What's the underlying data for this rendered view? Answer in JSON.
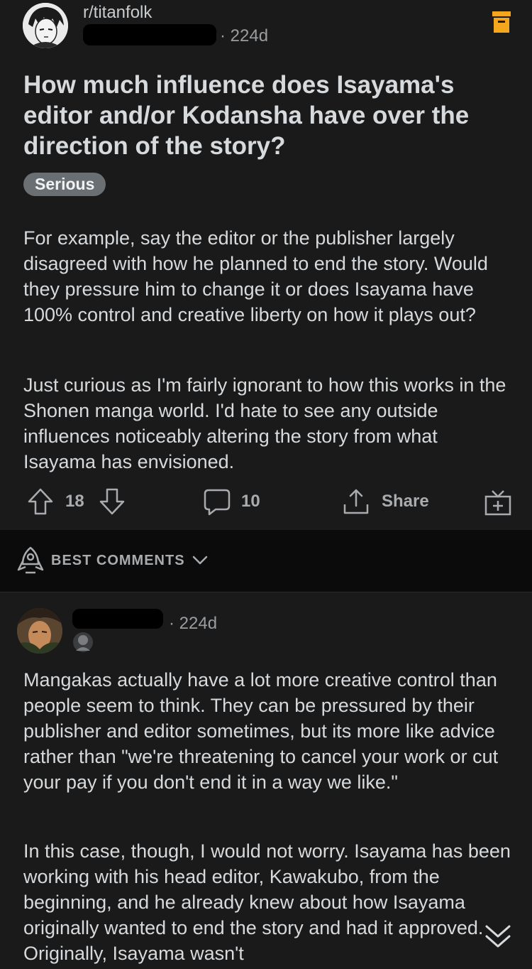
{
  "post": {
    "subreddit": "r/titanfolk",
    "age": "224d",
    "title": "How much influence does Isayama's editor and/or Kodansha have over the direction of the story?",
    "flair": "Serious",
    "paragraphs": [
      "For example, say the editor or the publisher largely disagreed with how he planned to end the story.  Would they pressure him to change it or does Isayama have 100% control and creative liberty on how it plays out?",
      "Just curious as I'm fairly ignorant to how this works in the Shonen manga world.   I'd hate to see any outside influences noticeably altering the story from what Isayama has envisioned."
    ],
    "votes": "18",
    "comments": "10",
    "share_label": "Share"
  },
  "sort": {
    "label": "BEST COMMENTS"
  },
  "comment": {
    "age": "224d",
    "paragraphs": [
      "Mangakas actually have a lot more creative control than people seem to think. They can be pressured by their publisher and editor sometimes, but its more like advice rather than \"we're threatening to cancel your work or cut your pay if you don't end it in a way we like.\"",
      "In this case, though, I would not worry. Isayama has been working with his head editor, Kawakubo, from the beginning, and he already knew about how Isayama originally wanted to end the story and had it approved. Originally, Isayama wasn't"
    ]
  },
  "colors": {
    "archive": "#f4a61d",
    "background": "#0b0b0b",
    "card": "#1a1a1b"
  }
}
